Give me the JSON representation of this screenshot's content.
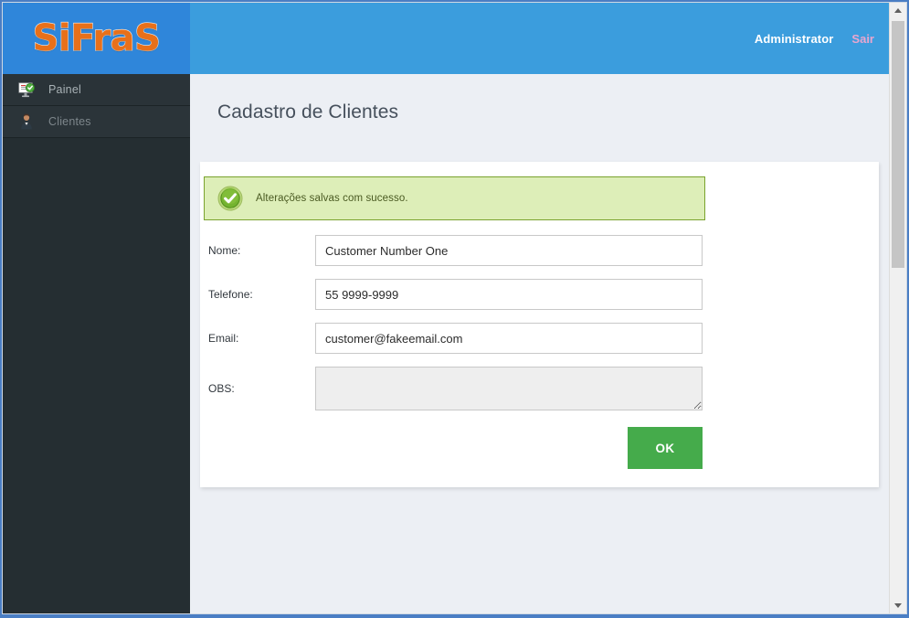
{
  "header": {
    "logo_text": "SiFraS",
    "user_name": "Administrator",
    "logout_label": "Sair",
    "bg_color": "#3b9ddd",
    "logo_bg_color": "#2f86da",
    "logo_color": "#e8701a",
    "logout_color": "#e9a6cf"
  },
  "sidebar": {
    "bg_color": "#252e32",
    "items": [
      {
        "label": "Painel",
        "icon": "monitor-dashboard-icon",
        "active": false
      },
      {
        "label": "Clientes",
        "icon": "user-client-icon",
        "active": true
      }
    ]
  },
  "main": {
    "page_title": "Cadastro de Clientes",
    "alert": {
      "text": "Alterações salvas com sucesso.",
      "icon": "success-check-icon",
      "bg_color": "#ddeeb8",
      "border_color": "#7aa32e",
      "text_color": "#4a5a22"
    },
    "form": {
      "fields": [
        {
          "label": "Nome:",
          "value": "Customer Number One",
          "placeholder": "",
          "type": "text",
          "name": "nome"
        },
        {
          "label": "Telefone:",
          "value": "55 9999-9999",
          "placeholder": "",
          "type": "text",
          "name": "telefone"
        },
        {
          "label": "Email:",
          "value": "customer@fakeemail.com",
          "placeholder": "",
          "type": "text",
          "name": "email"
        },
        {
          "label": "OBS:",
          "value": "",
          "placeholder": "",
          "type": "textarea",
          "name": "obs"
        }
      ],
      "submit_label": "OK",
      "submit_color": "#45ab4b"
    }
  },
  "scrollbar": {
    "up_arrow": "chevron-up-icon",
    "down_arrow": "chevron-down-icon"
  }
}
